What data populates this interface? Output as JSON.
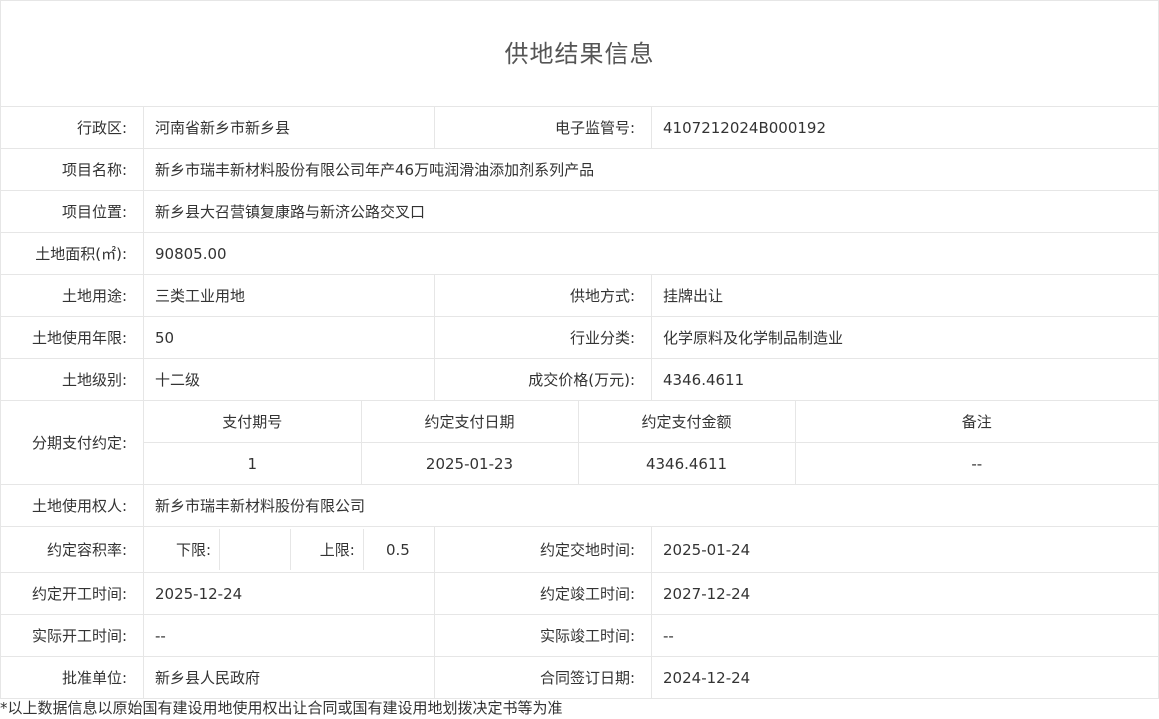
{
  "page_title": "供地结果信息",
  "rows": {
    "admin_region": {
      "label": "行政区:",
      "value": "河南省新乡市新乡县"
    },
    "e_supervision_no": {
      "label": "电子监管号:",
      "value": "4107212024B000192"
    },
    "project_name": {
      "label": "项目名称:",
      "value": "新乡市瑞丰新材料股份有限公司年产46万吨润滑油添加剂系列产品"
    },
    "project_location": {
      "label": "项目位置:",
      "value": "新乡县大召营镇复康路与新济公路交叉口"
    },
    "land_area": {
      "label": "土地面积(㎡):",
      "value": "90805.00"
    },
    "land_use": {
      "label": "土地用途:",
      "value": "三类工业用地"
    },
    "supply_method": {
      "label": "供地方式:",
      "value": "挂牌出让"
    },
    "land_use_term": {
      "label": "土地使用年限:",
      "value": "50"
    },
    "industry": {
      "label": "行业分类:",
      "value": "化学原料及化学制品制造业"
    },
    "land_grade": {
      "label": "土地级别:",
      "value": "十二级"
    },
    "deal_price": {
      "label": "成交价格(万元):",
      "value": "4346.4611"
    },
    "installments": {
      "label": "分期支付约定:",
      "headers": [
        "支付期号",
        "约定支付日期",
        "约定支付金额",
        "备注"
      ],
      "rows": [
        [
          "1",
          "2025-01-23",
          "4346.4611",
          "--"
        ]
      ]
    },
    "land_user": {
      "label": "土地使用权人:",
      "value": "新乡市瑞丰新材料股份有限公司"
    },
    "far": {
      "label": "约定容积率:",
      "lower_label": "下限:",
      "lower_value": "",
      "upper_label": "上限:",
      "upper_value": "0.5"
    },
    "handover_time": {
      "label": "约定交地时间:",
      "value": "2025-01-24"
    },
    "start_time": {
      "label": "约定开工时间:",
      "value": "2025-12-24"
    },
    "completion_time": {
      "label": "约定竣工时间:",
      "value": "2027-12-24"
    },
    "actual_start": {
      "label": "实际开工时间:",
      "value": "--"
    },
    "actual_completion": {
      "label": "实际竣工时间:",
      "value": "--"
    },
    "approval_unit": {
      "label": "批准单位:",
      "value": "新乡县人民政府"
    },
    "contract_date": {
      "label": "合同签订日期:",
      "value": "2024-12-24"
    }
  },
  "footnote": "*以上数据信息以原始国有建设用地使用权出让合同或国有建设用地划拨决定书等为准"
}
